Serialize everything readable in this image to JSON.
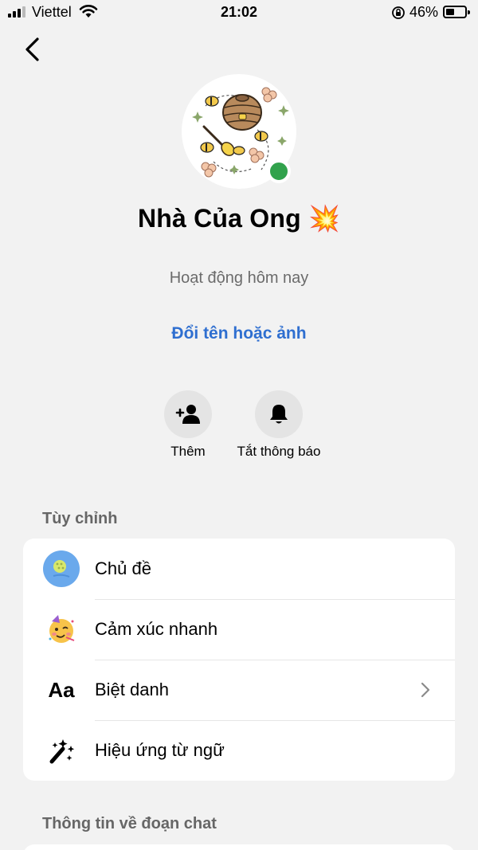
{
  "status_bar": {
    "carrier": "Viettel",
    "time": "21:02",
    "battery_percent": "46%",
    "battery_level": 0.46,
    "signal_bars": 3
  },
  "profile": {
    "name": "Nhà Của Ong 💥",
    "activity": "Hoạt động hôm nay",
    "rename_link": "Đổi tên hoặc ảnh",
    "online": true
  },
  "actions": [
    {
      "label": "Thêm",
      "icon": "add-person-icon"
    },
    {
      "label": "Tắt thông báo",
      "icon": "bell-icon"
    }
  ],
  "customize": {
    "title": "Tùy chỉnh",
    "items": [
      {
        "label": "Chủ đề",
        "icon": "theme-icon"
      },
      {
        "label": "Cảm xúc nhanh",
        "icon": "party-face-emoji-icon"
      },
      {
        "label": "Biệt danh",
        "icon": "aa-text-icon",
        "has_chevron": true
      },
      {
        "label": "Hiệu ứng từ ngữ",
        "icon": "magic-wand-icon"
      }
    ]
  },
  "chat_info": {
    "title": "Thông tin về đoạn chat"
  },
  "colors": {
    "accent_link": "#2f6fd0",
    "online_dot": "#31a24c",
    "background": "#f2f2f2",
    "theme_blue": "#6aa9ec"
  }
}
